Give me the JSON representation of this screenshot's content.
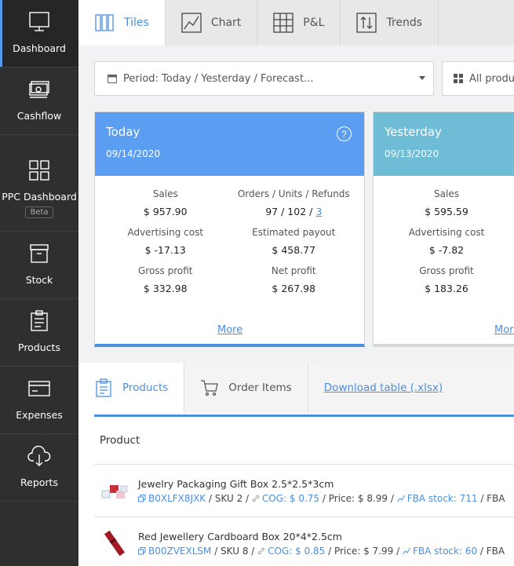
{
  "sidebar": {
    "items": [
      {
        "label": "Dashboard",
        "icon": "monitor-icon"
      },
      {
        "label": "Cashflow",
        "icon": "cash-icon"
      },
      {
        "label": "PPC Dashboard",
        "icon": "grid-icon",
        "badge": "Beta"
      },
      {
        "label": "Stock",
        "icon": "box-icon"
      },
      {
        "label": "Products",
        "icon": "clipboard-icon"
      },
      {
        "label": "Expenses",
        "icon": "card-icon"
      },
      {
        "label": "Reports",
        "icon": "cloud-download-icon"
      }
    ]
  },
  "tabs": [
    {
      "label": "Tiles",
      "icon": "tiles-icon"
    },
    {
      "label": "Chart",
      "icon": "line-chart-icon"
    },
    {
      "label": "P&L",
      "icon": "table-icon"
    },
    {
      "label": "Trends",
      "icon": "trends-icon"
    }
  ],
  "filters": {
    "period": "Period: Today / Yesterday / Forecast...",
    "products": "All produ"
  },
  "cards": {
    "today": {
      "title": "Today",
      "date": "09/14/2020",
      "help": "?",
      "metrics": [
        {
          "label": "Sales",
          "value": "$ 957.90"
        },
        {
          "label": "Orders / Units / Refunds",
          "value": "97 / 102 / ",
          "link": "3"
        },
        {
          "label": "Advertising cost",
          "value": "$ -17.13"
        },
        {
          "label": "Estimated payout",
          "value": "$ 458.77"
        },
        {
          "label": "Gross profit",
          "value": "$ 332.98"
        },
        {
          "label": "Net profit",
          "value": "$ 267.98"
        }
      ],
      "more": "More"
    },
    "yesterday": {
      "title": "Yesterday",
      "date": "09/13/2020",
      "metrics": [
        {
          "label": "Sales",
          "value": "$ 595.59"
        },
        {
          "label": "Advertising cost",
          "value": "$ -7.82"
        },
        {
          "label": "Gross profit",
          "value": "$ 183.26"
        }
      ],
      "more": "More"
    }
  },
  "bottom": {
    "tabs": [
      {
        "label": "Products"
      },
      {
        "label": "Order Items"
      },
      {
        "label": "Download table (.xlsx)"
      }
    ],
    "table_header": "Product",
    "rows": [
      {
        "name": "Jewelry Packaging Gift Box 2.5*2.5*3cm",
        "asin": "B0XLFX8JXK",
        "sku": " / SKU 2 / ",
        "cog": "COG: $ 0.75",
        "price": " / Price: $ 8.99 / ",
        "fba": "FBA stock: 711",
        "tail": " / FBA"
      },
      {
        "name": "Red Jewellery Cardboard Box 20*4*2.5cm",
        "asin": "B00ZVEXLSM",
        "sku": " / SKU 8 / ",
        "cog": "COG: $ 0.85",
        "price": " / Price: $ 7.99 / ",
        "fba": "FBA stock: 60",
        "tail": " / FBA"
      }
    ]
  },
  "colors": {
    "accent": "#4a8fe0",
    "today": "#5b9df0",
    "yesterday": "#6fbcd6",
    "sidebar": "#2f2f2f"
  }
}
